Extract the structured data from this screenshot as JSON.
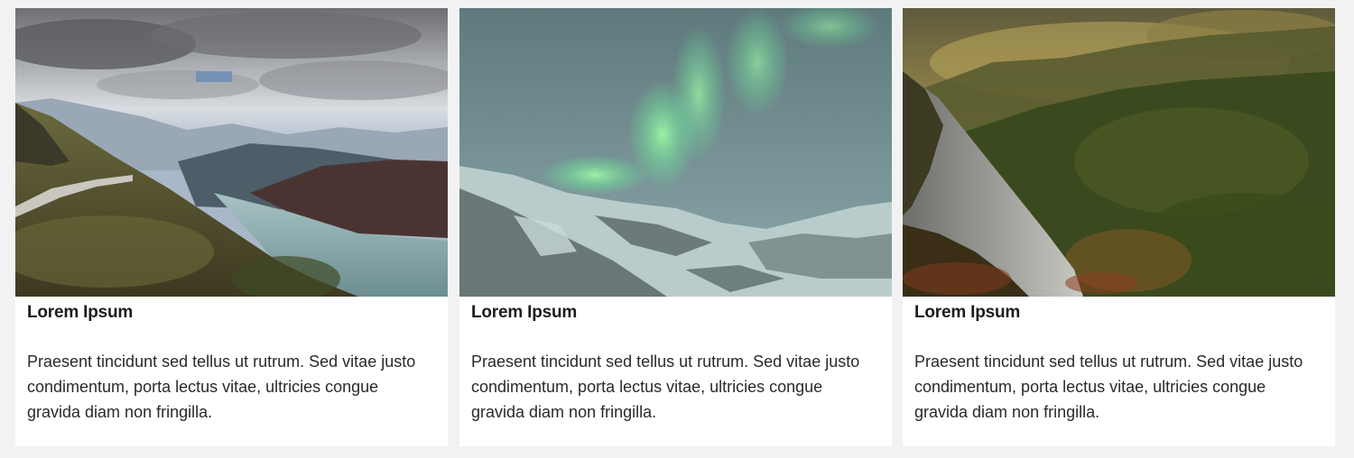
{
  "cards": [
    {
      "title": "Lorem Ipsum",
      "text": "Praesent tincidunt sed tellus ut rutrum. Sed vitae justo condimentum, porta lectus vitae, ultricies congue gravida diam non fringilla.",
      "image": "mountain-lake-landscape-photo"
    },
    {
      "title": "Lorem Ipsum",
      "text": "Praesent tincidunt sed tellus ut rutrum. Sed vitae justo condimentum, porta lectus vitae, ultricies congue gravida diam non fringilla.",
      "image": "northern-lights-snow-mountains-photo"
    },
    {
      "title": "Lorem Ipsum",
      "text": "Praesent tincidunt sed tellus ut rutrum. Sed vitae justo condimentum, porta lectus vitae, ultricies congue gravida diam non fringilla.",
      "image": "forest-valley-cliff-photo"
    }
  ],
  "colors": {
    "page_background": "#f2f2f2",
    "card_background": "#ffffff",
    "title_text": "#1c1c1c",
    "body_text": "#2a2a2a"
  }
}
